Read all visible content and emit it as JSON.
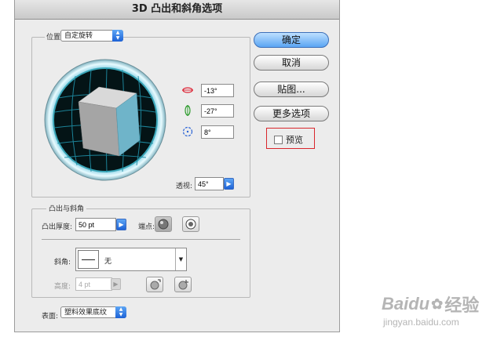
{
  "dialog": {
    "title": "3D 凸出和斜角选项",
    "position": {
      "label": "位置:",
      "value": "自定旋转"
    },
    "rotation": {
      "x": "-13°",
      "y": "-27°",
      "z": "8°"
    },
    "perspective": {
      "label": "透视:",
      "value": "45°"
    },
    "extrude": {
      "section_label": "凸出与斜角",
      "depth_label": "凸出厚度:",
      "depth_value": "50 pt",
      "cap_label": "端点:",
      "bevel_label": "斜角:",
      "bevel_value": "无",
      "height_label": "高度:",
      "height_value": "4 pt"
    },
    "surface": {
      "label": "表面:",
      "value": "塑料效果底纹"
    },
    "buttons": {
      "ok": "确定",
      "cancel": "取消",
      "map": "贴图...",
      "more": "更多选项",
      "preview": "预览"
    },
    "colors": {
      "cube_front": "#6fb4c9",
      "cube_top": "#d9d9d9",
      "cube_side": "#a5a5a5",
      "highlight_box": "#d9262c"
    }
  },
  "watermark": {
    "brand": "Baidu",
    "sub": "经验",
    "url": "jingyan.baidu.com"
  }
}
